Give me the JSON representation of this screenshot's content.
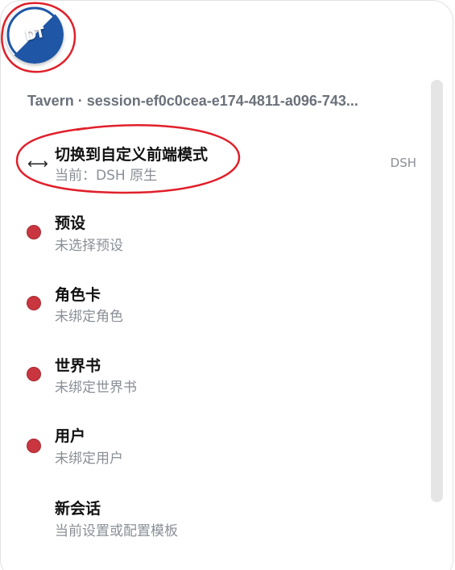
{
  "logo": {
    "text": "DT",
    "color_primary": "#1f56a6",
    "color_secondary": "#ffffff"
  },
  "header": {
    "title": "Tavern · session-ef0c0cea-e174-4811-a096-743..."
  },
  "mode_switch": {
    "icon": "left-right-arrow-icon",
    "title": "切换到自定义前端模式",
    "subtitle": "当前：DSH 原生",
    "badge": "DSH"
  },
  "items": [
    {
      "title": "预设",
      "subtitle": "未选择预设",
      "status_color": "#c9363f"
    },
    {
      "title": "角色卡",
      "subtitle": "未绑定角色",
      "status_color": "#c9363f"
    },
    {
      "title": "世界书",
      "subtitle": "未绑定世界书",
      "status_color": "#c9363f"
    },
    {
      "title": "用户",
      "subtitle": "未绑定用户",
      "status_color": "#c9363f"
    }
  ],
  "new_session": {
    "title": "新会话",
    "subtitle": "当前设置或配置模板"
  },
  "annotation_color": "#e0202a"
}
